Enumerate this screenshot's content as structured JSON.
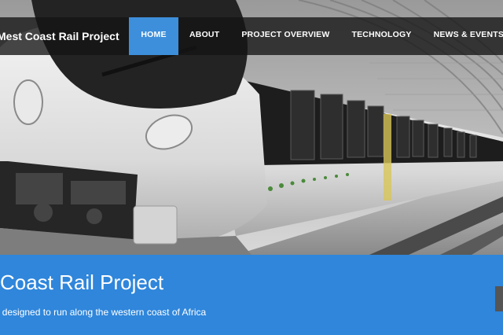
{
  "nav": {
    "brand": "Mest Coast Rail Project",
    "items": [
      {
        "label": "HOME",
        "active": true
      },
      {
        "label": "ABOUT",
        "active": false
      },
      {
        "label": "PROJECT OVERVIEW",
        "active": false
      },
      {
        "label": "TECHNOLOGY",
        "active": false
      },
      {
        "label": "NEWS & EVENTS",
        "active": false
      }
    ]
  },
  "hero": {
    "image": "high-speed-train-photo"
  },
  "banner": {
    "title": "West Coast Rail Project",
    "subtitle": "Rail Project designed to run along the western coast of Africa"
  },
  "colors": {
    "nav_bg": "#141414",
    "accent": "#3d8fdb",
    "banner_bg": "#2f86db",
    "text": "#ffffff"
  }
}
